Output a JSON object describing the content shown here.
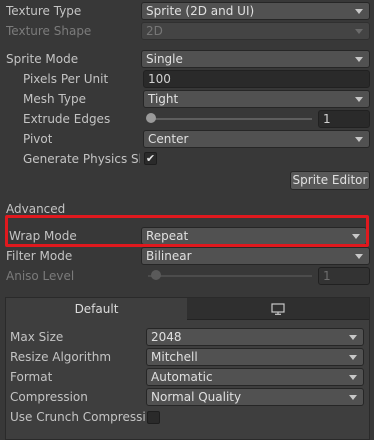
{
  "rows": {
    "texture_type": {
      "label": "Texture Type",
      "value": "Sprite (2D and UI)"
    },
    "texture_shape": {
      "label": "Texture Shape",
      "value": "2D"
    },
    "sprite_mode": {
      "label": "Sprite Mode",
      "value": "Single"
    },
    "pixels_per_unit": {
      "label": "Pixels Per Unit",
      "value": "100"
    },
    "mesh_type": {
      "label": "Mesh Type",
      "value": "Tight"
    },
    "extrude_edges": {
      "label": "Extrude Edges",
      "value": "1"
    },
    "pivot": {
      "label": "Pivot",
      "value": "Center"
    },
    "generate_physics_shape": {
      "label": "Generate Physics Sha",
      "checked_glyph": "✔"
    },
    "sprite_editor_button": "Sprite Editor",
    "advanced_header": "Advanced",
    "wrap_mode": {
      "label": "Wrap Mode",
      "value": "Repeat"
    },
    "filter_mode": {
      "label": "Filter Mode",
      "value": "Bilinear"
    },
    "aniso_level": {
      "label": "Aniso Level",
      "value": "1"
    }
  },
  "platform_tabs": {
    "default_label": "Default",
    "platform_icon": "monitor-icon"
  },
  "platform_settings": {
    "max_size": {
      "label": "Max Size",
      "value": "2048"
    },
    "resize_algorithm": {
      "label": "Resize Algorithm",
      "value": "Mitchell"
    },
    "format": {
      "label": "Format",
      "value": "Automatic"
    },
    "compression": {
      "label": "Compression",
      "value": "Normal Quality"
    },
    "use_crunch_compression": {
      "label": "Use Crunch Compressio"
    }
  },
  "colors": {
    "background": "#383838",
    "highlight_border": "#e0191e"
  }
}
